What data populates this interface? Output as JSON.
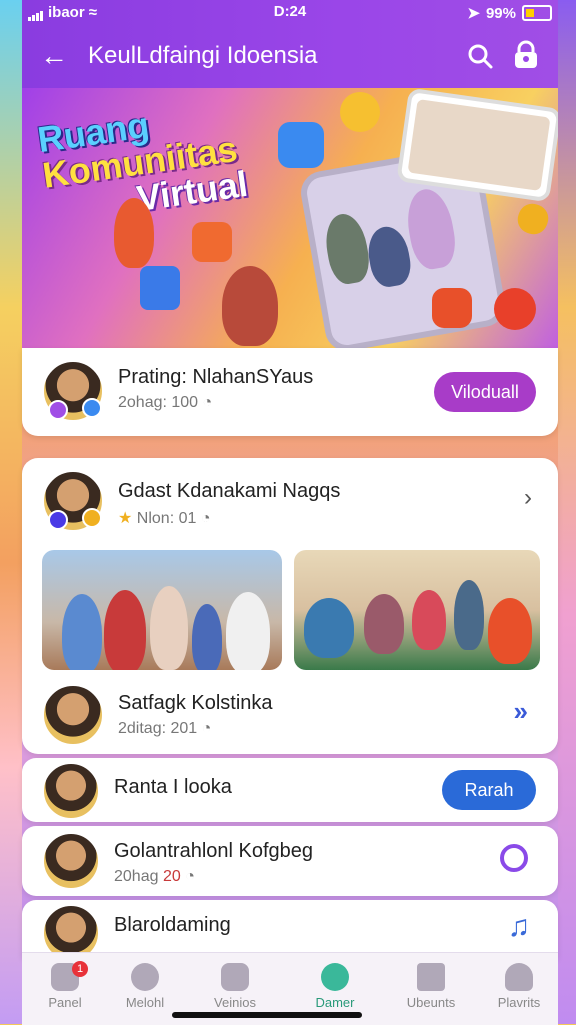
{
  "status_bar": {
    "carrier": "ibaor",
    "time": "D:24",
    "battery": "99%",
    "battery_level": 0.99
  },
  "header": {
    "title": "KeulLdfaingi Idoensia"
  },
  "banner": {
    "title_lines": [
      "Ruang",
      "Komuniitas",
      "Virtual"
    ]
  },
  "featured": {
    "name": "Prating: NlahanSYaus",
    "sub": "2ohag: 100",
    "button": "Viloduall"
  },
  "group": {
    "title": "Gdast Kdanakami Nagqs",
    "meta": "Nlon: 01"
  },
  "list": [
    {
      "name": "Satfagk Kolstinka",
      "sub": "2ditag: 201",
      "action_icon": "double-chevron-icon"
    },
    {
      "name": "Ranta I looka",
      "button": "Rarah"
    },
    {
      "name": "Golantrahlonl Kofgbeg",
      "sub": "20hag",
      "sub_value": "20",
      "action_icon": "share-icon"
    },
    {
      "name": "Blaroldaming",
      "action_icon": "music-notes-icon"
    }
  ],
  "nav": [
    {
      "label": "Panel",
      "badge": "1"
    },
    {
      "label": "Melohl"
    },
    {
      "label": "Veinios"
    },
    {
      "label": "Damer",
      "active": true
    },
    {
      "label": "Ubeunts"
    },
    {
      "label": "Plavrits"
    }
  ],
  "colors": {
    "brand": "#9a46e8",
    "button": "#a83cc8",
    "blue_button": "#2a6ad8",
    "active_nav": "#3ab89a"
  }
}
